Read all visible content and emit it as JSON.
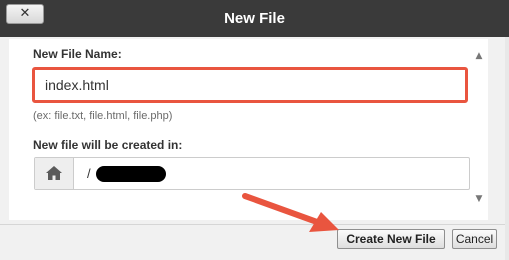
{
  "window": {
    "title": "New File",
    "close_label": "✕"
  },
  "form": {
    "name_label": "New File Name:",
    "name_value": "index.html",
    "name_hint": "(ex: file.txt, file.html, file.php)",
    "dir_label": "New file will be created in:",
    "dir_value": "/"
  },
  "buttons": {
    "create": "Create New File",
    "cancel": "Cancel"
  },
  "colors": {
    "highlight": "#e9553f",
    "titlebar": "#3a3a3a"
  },
  "icons": {
    "home": "home-icon",
    "close": "close-icon",
    "annotation": "annotation-arrow"
  }
}
